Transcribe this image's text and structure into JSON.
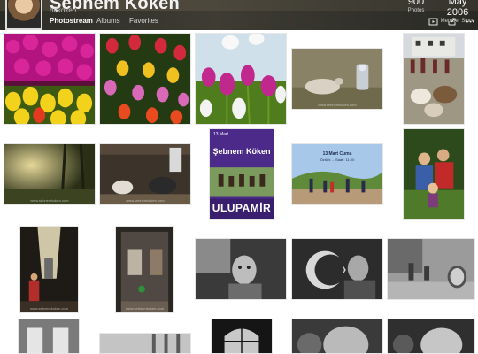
{
  "profile": {
    "name": "Şebnem Köken",
    "handle": "hdkoken",
    "stats": [
      {
        "value": "900",
        "label": "Photos"
      },
      {
        "value": "May 2006",
        "label": "Member Since"
      }
    ]
  },
  "nav": {
    "tabs": [
      {
        "label": "Photostream",
        "active": true
      },
      {
        "label": "Albums",
        "active": false
      },
      {
        "label": "Favorites",
        "active": false
      }
    ],
    "actions": [
      "slideshow-icon",
      "share-icon",
      "more-icon"
    ]
  },
  "photos": [
    {
      "subject": "tulips-pink-yellow"
    },
    {
      "subject": "tulips-mixed"
    },
    {
      "subject": "tulips-closeup"
    },
    {
      "subject": "goat-resting"
    },
    {
      "subject": "village-goats"
    },
    {
      "subject": "forest-light"
    },
    {
      "subject": "barn-goat"
    },
    {
      "subject": "event-poster",
      "poster_top": "13 Mart",
      "poster_name": "Şebnem Köken",
      "poster_sub": "",
      "poster_bottom": "ULUPAMİR"
    },
    {
      "subject": "playground-event",
      "event_title": "13 Mart Cuma",
      "event_sub": "Öztürk ... Saat : 11:00"
    },
    {
      "subject": "boys-child"
    },
    {
      "subject": "old-alley"
    },
    {
      "subject": "doorway"
    },
    {
      "subject": "boy-portrait-bw"
    },
    {
      "subject": "flag-boy-bw"
    },
    {
      "subject": "children-street-bw"
    },
    {
      "subject": "train-window"
    },
    {
      "subject": "building-bw"
    },
    {
      "subject": "arched-window-bw"
    },
    {
      "subject": "boy-closeup-bw"
    },
    {
      "subject": "boy-closeup-bw-2"
    }
  ],
  "watermark": "www.sebnemkoken.com",
  "colors": {
    "header_bg": "#33322b",
    "poster_purple": "#4b2a8a"
  }
}
